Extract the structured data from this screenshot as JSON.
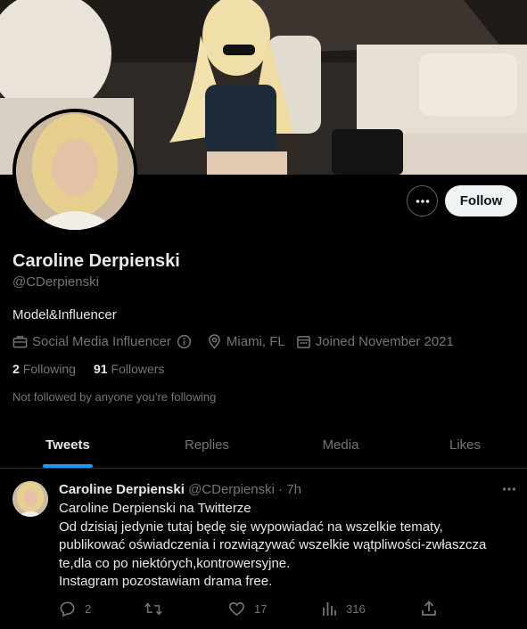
{
  "profile": {
    "name": "Caroline Derpienski",
    "handle": "@CDerpienski",
    "bio": "Model&Influencer",
    "category": "Social Media Influencer",
    "location": "Miami, FL",
    "joined": "Joined November 2021",
    "following_count": "2",
    "following_label": "Following",
    "followers_count": "91",
    "followers_label": "Followers",
    "not_followed_text": "Not followed by anyone you’re following"
  },
  "actions": {
    "follow_label": "Follow"
  },
  "tabs": [
    {
      "label": "Tweets",
      "active": true
    },
    {
      "label": "Replies",
      "active": false
    },
    {
      "label": "Media",
      "active": false
    },
    {
      "label": "Likes",
      "active": false
    }
  ],
  "tweet": {
    "author": "Caroline Derpienski",
    "handle_time": "@CDerpienski · 7h",
    "lines": [
      "Caroline Derpienski na Twitterze",
      "Od dzisiaj jedynie tutaj będę się wypowiadać na wszelkie tematy,",
      "publikować oświadczenia i rozwiązywać wszelkie wątpliwości-zwłaszcza",
      "te,dla co po niektórych,kontrowersyjne.",
      "Instagram pozostawiam drama free."
    ],
    "replies": "2",
    "likes": "17",
    "views": "316"
  },
  "colors": {
    "accent": "#1d9bf0",
    "muted": "#71767b",
    "text": "#e7e9ea",
    "background": "#000000"
  },
  "icons": [
    "more-icon",
    "briefcase-icon",
    "info-icon",
    "location-icon",
    "calendar-icon",
    "reply-icon",
    "retweet-icon",
    "like-icon",
    "views-icon",
    "share-icon"
  ]
}
